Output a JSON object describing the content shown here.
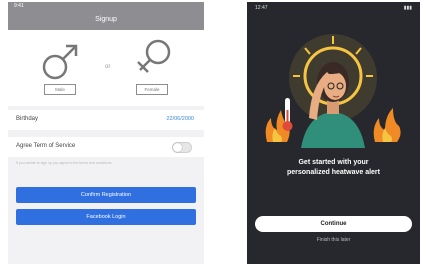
{
  "left_screen": {
    "status_time": "9:41",
    "nav_title": "Signup",
    "gender": {
      "male_label": "Male",
      "or_label": "or",
      "female_label": "Female"
    },
    "birthday": {
      "label": "Birthday",
      "value": "22/06/2000"
    },
    "terms": {
      "label": "Agree Term of Service",
      "toggle_on": false
    },
    "hint_text": "If you decide to sign up you agree to the terms and conditions",
    "register_button": "Confirm Registration",
    "facebook_button": "Facebook Login",
    "colors": {
      "nav": "#8e8e92",
      "button": "#2f6fe0",
      "link": "#3b87d6"
    }
  },
  "right_screen": {
    "status_time": "12:47",
    "headline_line1": "Get started with your",
    "headline_line2": "personalized heatwave alert",
    "continue_button": "Continue",
    "later_link": "Finish this later",
    "colors": {
      "background": "#27282d",
      "sun": "#f5c542",
      "flame": "#f08a24",
      "shirt": "#2f8f7a"
    }
  }
}
